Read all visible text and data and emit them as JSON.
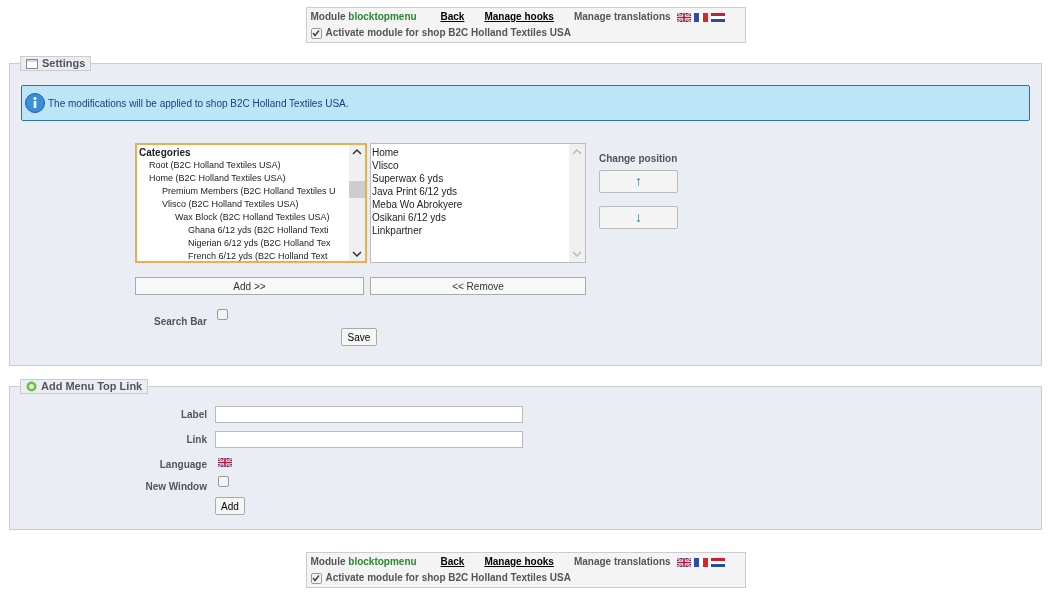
{
  "toolbar_top": {
    "module_prefix": "Module",
    "module_name": "blocktopmenu",
    "back": "Back",
    "manage_hooks": "Manage hooks",
    "manage_translations": "Manage translations",
    "activate": {
      "label": "Activate module for shop B2C Holland Textiles USA",
      "checked": true
    }
  },
  "settings": {
    "legend": "Settings",
    "info": "The modifications will be applied to shop B2C Holland Textiles USA.",
    "categories": {
      "header": "Categories",
      "items": [
        {
          "label": "Root (B2C Holland Textiles USA)"
        },
        {
          "label": "Home (B2C Holland Textiles USA)",
          "children": [
            {
              "label": "Premium Members (B2C Holland Textiles U"
            },
            {
              "label": "Vlisco (B2C Holland Textiles USA)",
              "children": [
                {
                  "label": "Wax Block (B2C Holland Textiles USA)",
                  "children": [
                    {
                      "label": "Ghana 6/12 yds (B2C Holland Texti"
                    },
                    {
                      "label": "Nigerian 6/12 yds (B2C Holland Tex"
                    },
                    {
                      "label": "French 6/12 yds (B2C Holland Text"
                    }
                  ]
                }
              ]
            }
          ]
        }
      ]
    },
    "selected_items": [
      "Home",
      "Vlisco",
      "Superwax 6 yds",
      "Java Print 6/12 yds",
      "Meba Wo Abrokyere",
      "Osikani 6/12 yds",
      "Linkpartner"
    ],
    "change_position": "Change position",
    "up": "↑",
    "down": "↓",
    "add": "Add >>",
    "remove": "<< Remove",
    "search_bar": {
      "label": "Search Bar",
      "checked": false
    },
    "save": "Save"
  },
  "add_link": {
    "legend": "Add Menu Top Link",
    "label_field": {
      "label": "Label"
    },
    "link_field": {
      "label": "Link"
    },
    "language": "Language",
    "new_window": {
      "label": "New Window",
      "checked": false
    },
    "add": "Add"
  },
  "toolbar_bottom": {
    "module_prefix": "Module",
    "module_name": "blocktopmenu",
    "back": "Back",
    "manage_hooks": "Manage hooks",
    "manage_translations": "Manage translations",
    "activate": {
      "label": "Activate module for shop B2C Holland Textiles USA",
      "checked": true
    }
  }
}
